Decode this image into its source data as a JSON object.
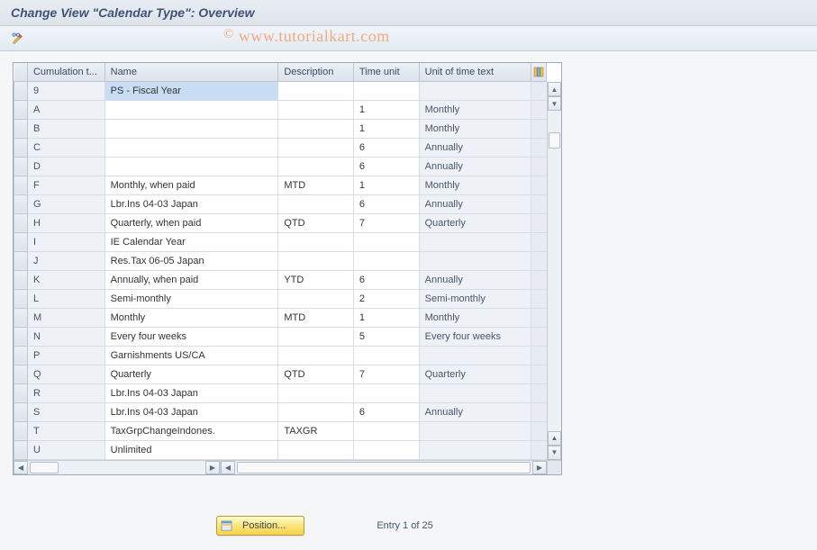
{
  "titlebar": {
    "title": "Change View \"Calendar Type\": Overview"
  },
  "watermark": "www.tutorialkart.com",
  "columns": {
    "cumulation": "Cumulation t...",
    "name": "Name",
    "description": "Description",
    "time_unit": "Time unit",
    "unit_text": "Unit of time text"
  },
  "rows": [
    {
      "ct": "9",
      "name": "PS - Fiscal Year",
      "desc": "",
      "time": "",
      "unit": "",
      "selected": true
    },
    {
      "ct": "A",
      "name": "",
      "desc": "",
      "time": "1",
      "unit": "Monthly"
    },
    {
      "ct": "B",
      "name": "",
      "desc": "",
      "time": "1",
      "unit": "Monthly"
    },
    {
      "ct": "C",
      "name": "",
      "desc": "",
      "time": "6",
      "unit": "Annually"
    },
    {
      "ct": "D",
      "name": "",
      "desc": "",
      "time": "6",
      "unit": "Annually"
    },
    {
      "ct": "F",
      "name": "Monthly, when paid",
      "desc": "MTD",
      "time": "1",
      "unit": "Monthly"
    },
    {
      "ct": "G",
      "name": "Lbr.Ins 04-03  Japan",
      "desc": "",
      "time": "6",
      "unit": "Annually"
    },
    {
      "ct": "H",
      "name": "Quarterly, when paid",
      "desc": "QTD",
      "time": "7",
      "unit": "Quarterly"
    },
    {
      "ct": "I",
      "name": "IE Calendar Year",
      "desc": "",
      "time": "",
      "unit": ""
    },
    {
      "ct": "J",
      "name": "Res.Tax 06-05  Japan",
      "desc": "",
      "time": "",
      "unit": ""
    },
    {
      "ct": "K",
      "name": "Annually, when paid",
      "desc": "YTD",
      "time": "6",
      "unit": "Annually"
    },
    {
      "ct": "L",
      "name": "Semi-monthly",
      "desc": "",
      "time": "2",
      "unit": "Semi-monthly"
    },
    {
      "ct": "M",
      "name": "Monthly",
      "desc": "MTD",
      "time": "1",
      "unit": "Monthly"
    },
    {
      "ct": "N",
      "name": "Every four weeks",
      "desc": "",
      "time": "5",
      "unit": "Every four weeks"
    },
    {
      "ct": "P",
      "name": "Garnishments US/CA",
      "desc": "",
      "time": "",
      "unit": ""
    },
    {
      "ct": "Q",
      "name": "Quarterly",
      "desc": "QTD",
      "time": "7",
      "unit": "Quarterly"
    },
    {
      "ct": "R",
      "name": "Lbr.Ins 04-03  Japan",
      "desc": "",
      "time": "",
      "unit": ""
    },
    {
      "ct": "S",
      "name": "Lbr.Ins 04-03  Japan",
      "desc": "",
      "time": "6",
      "unit": "Annually"
    },
    {
      "ct": "T",
      "name": "TaxGrpChangeIndones.",
      "desc": "TAXGR",
      "time": "",
      "unit": ""
    },
    {
      "ct": "U",
      "name": "Unlimited",
      "desc": "",
      "time": "",
      "unit": ""
    }
  ],
  "footer": {
    "position_label": "Position...",
    "entry_text": "Entry 1 of 25"
  }
}
